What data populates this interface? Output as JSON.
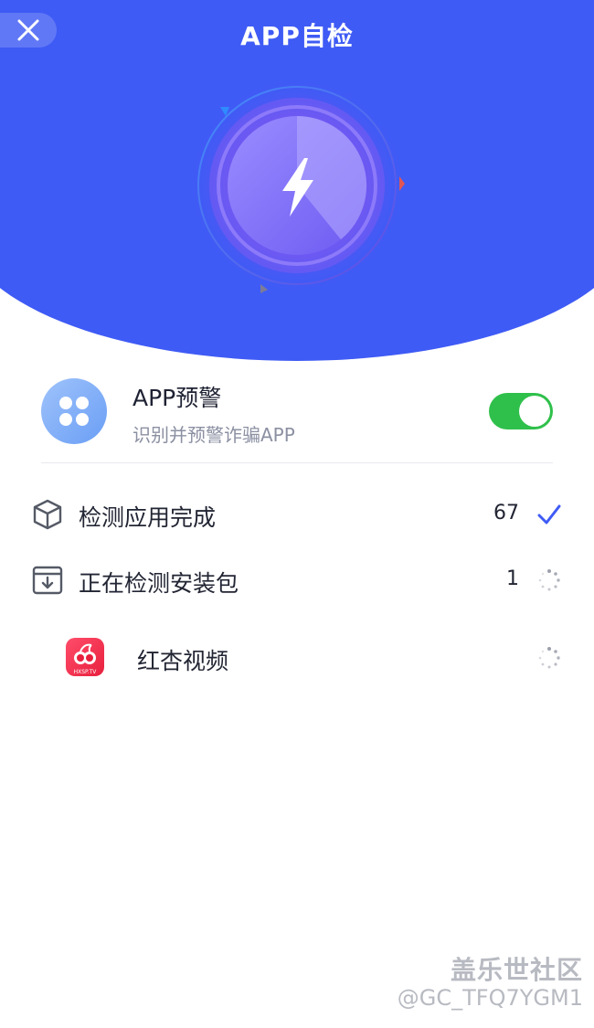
{
  "header": {
    "title": "APP自检",
    "close_icon": "close-icon",
    "bg_color": "#3F5BF5"
  },
  "gauge": {
    "icon": "lightning-icon"
  },
  "warning_card": {
    "icon": "grid-icon",
    "title": "APP预警",
    "subtitle": "识别并预警诈骗APP",
    "toggle_on": true,
    "toggle_color": "#2fc04b"
  },
  "rows": [
    {
      "icon": "cube-icon",
      "label": "检测应用完成",
      "count": "67",
      "status_icon": "check-icon"
    },
    {
      "icon": "install-package-icon",
      "label": "正在检测安装包",
      "count": "1",
      "status_icon": "loading-spinner-icon"
    }
  ],
  "app_item": {
    "name": "红杏视频",
    "icon_text": "HXSP.TV",
    "status_icon": "loading-spinner-icon"
  },
  "watermark": {
    "line1": "盖乐世社区",
    "line2": "@GC_TFQ7YGM1"
  }
}
